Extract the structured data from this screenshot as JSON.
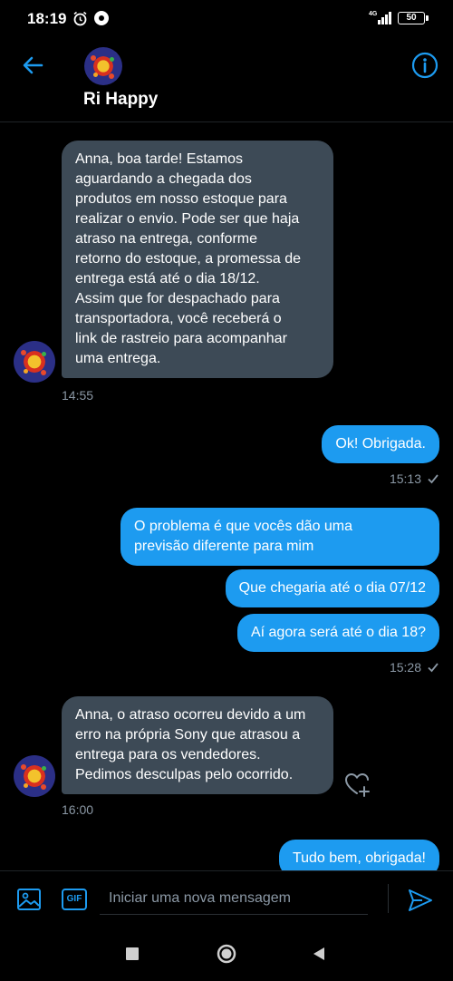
{
  "status": {
    "time": "18:19",
    "network": "4G",
    "battery": "50"
  },
  "header": {
    "name": "Ri Happy"
  },
  "messages": {
    "m1": {
      "lines": [
        "Anna, boa tarde! Estamos",
        "aguardando a chegada dos",
        "produtos em nosso estoque para",
        "realizar o envio. Pode ser que haja",
        "atraso na entrega, conforme",
        "retorno do estoque, a promessa de",
        "entrega está até o dia 18/12.",
        "Assim que for despachado para",
        "transportadora, você receberá o",
        "link de rastreio para acompanhar",
        "uma entrega."
      ],
      "time": "14:55"
    },
    "m2": {
      "text": "Ok! Obrigada.",
      "time": "15:13"
    },
    "m3": {
      "lines": [
        "O problema é que vocês dão uma",
        "previsão diferente para mim"
      ]
    },
    "m4": {
      "text": "Que chegaria até o dia 07/12"
    },
    "m5": {
      "text": "Aí agora será até o dia 18?",
      "time": "15:28"
    },
    "m6": {
      "lines": [
        "Anna, o atraso ocorreu devido a um",
        "erro na própria Sony que atrasou a",
        "entrega para os vendedores.",
        "Pedimos desculpas pelo ocorrido."
      ],
      "time": "16:00"
    },
    "m7": {
      "text": "Tudo bem, obrigada!"
    }
  },
  "composer": {
    "placeholder": "Iniciar uma nova mensagem",
    "gif_label": "GIF"
  },
  "colors": {
    "accent": "#1d9bf0",
    "received_bubble": "#3d4a56",
    "background": "#000000"
  },
  "icons": [
    "back-arrow-icon",
    "info-icon",
    "heart-plus-icon",
    "image-icon",
    "send-icon",
    "check-icon",
    "alarm-icon"
  ]
}
